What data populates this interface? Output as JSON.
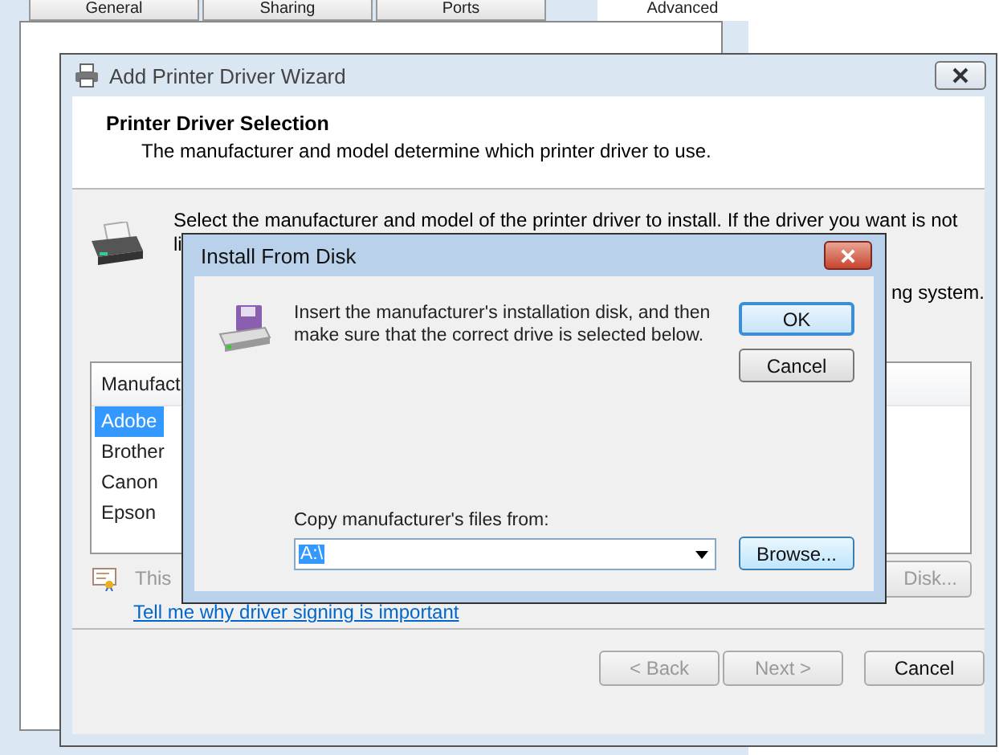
{
  "background_window": {
    "tabs": [
      {
        "label": "General",
        "selected": false
      },
      {
        "label": "Sharing",
        "selected": false
      },
      {
        "label": "Ports",
        "selected": false
      },
      {
        "label": "Advanced",
        "selected": true
      }
    ]
  },
  "wizard": {
    "title": "Add Printer Driver Wizard",
    "heading": "Printer Driver Selection",
    "subheading": "The manufacturer and model determine which printer driver to use.",
    "instruction_first_line": "Select the manufacturer and model of the printer driver to install. If the driver you want is not",
    "instruction_second_line": "li",
    "instruction_third_line_end": "ng system.",
    "list": {
      "header": "Manufact",
      "items": [
        {
          "label": "Adobe",
          "selected": true
        },
        {
          "label": "Brother",
          "selected": false
        },
        {
          "label": "Canon",
          "selected": false
        },
        {
          "label": "Epson",
          "selected": false
        }
      ]
    },
    "have_disk_button": "Disk...",
    "signing_text": "This",
    "signing_link": "Tell me why driver signing is important",
    "buttons": [
      {
        "label": "< Back",
        "disabled": true
      },
      {
        "label": "Next >",
        "disabled": true
      },
      {
        "label": "Cancel",
        "disabled": false
      }
    ]
  },
  "dialog": {
    "title": "Install From Disk",
    "message": "Insert the manufacturer's installation disk, and then make sure that the correct drive is selected below.",
    "buttons": [
      {
        "label": "OK",
        "focused": true
      },
      {
        "label": "Cancel",
        "focused": false
      }
    ],
    "path_label": "Copy manufacturer's files from:",
    "path_value": "A:\\",
    "browse_button": "Browse..."
  }
}
